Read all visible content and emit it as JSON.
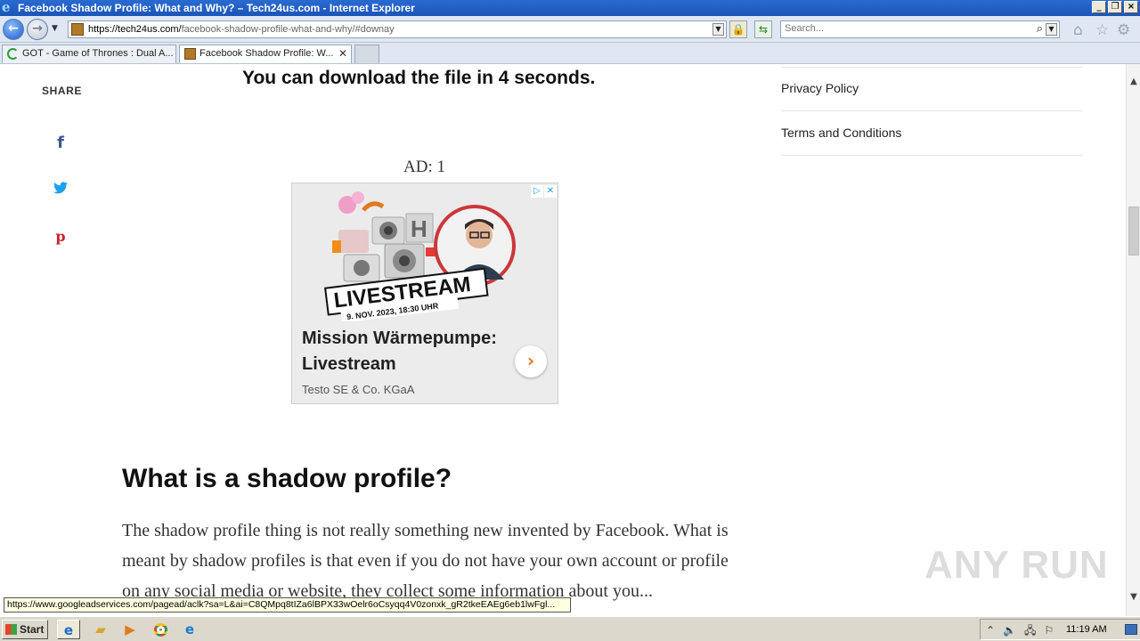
{
  "window": {
    "title": "Facebook Shadow Profile: What and Why? – Tech24us.com - Internet Explorer"
  },
  "address_bar": {
    "url_host": "https://tech24us.com/",
    "url_path": "facebook-shadow-profile-what-and-why/#downay",
    "search_placeholder": "Search..."
  },
  "tabs": [
    {
      "label": "GOT - Game of Thrones : Dual A..."
    },
    {
      "label": "Facebook Shadow Profile: W...",
      "close": "✕"
    }
  ],
  "page": {
    "share": {
      "label": "SHARE",
      "icons": [
        "facebook-icon",
        "twitter-icon",
        "pinterest-icon"
      ],
      "facebook_glyph": "f",
      "pinterest_glyph": "p"
    },
    "download_message": "You can download the file in 4 seconds.",
    "ad": {
      "label": "AD: 1",
      "image_text": "LIVESTREAM",
      "image_date": "9. NOV. 2023, 18:30 UHR",
      "headline": "Mission Wärmepumpe: Livestream",
      "sponsor": "Testo SE & Co. KGaA"
    },
    "heading": "What is a shadow profile?",
    "paragraph": "The shadow profile thing is not really something new invented by Facebook. What is meant by shadow profiles is that even if you do not have your own account or profile on any social media or website, they collect some information about you...",
    "sidebar_links": [
      "Privacy Policy",
      "Terms and Conditions"
    ],
    "watermark": "ANY RUN"
  },
  "status_link": "https://www.googleadservices.com/pagead/aclk?sa=L&ai=C8QMpq8tIZa6lBPX33wOelr6oCsyqq4V0zonxk_gR2tkeEAEg6eb1lwFgl...",
  "taskbar": {
    "start_label": "Start",
    "clock": "11:19 AM"
  }
}
